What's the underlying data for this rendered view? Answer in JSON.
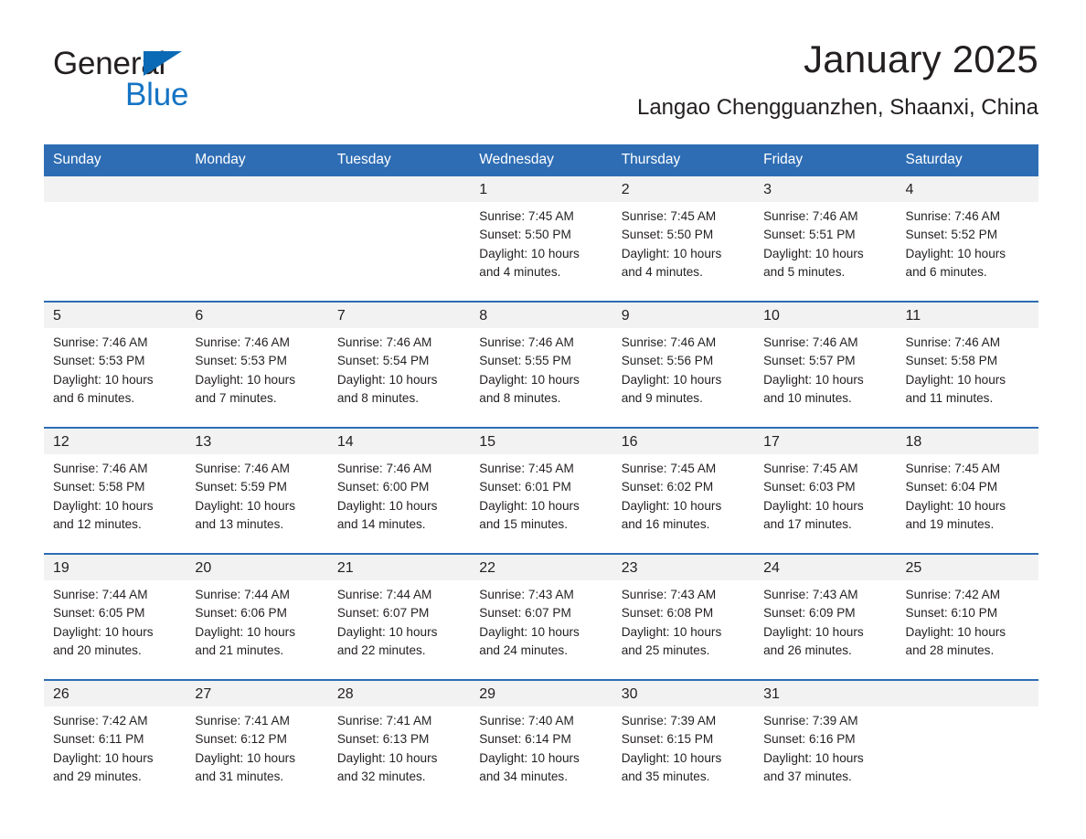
{
  "brand": {
    "name_part1": "General",
    "name_part2": "Blue",
    "accent_color": "#1574c4",
    "triangle_color": "#0b6ab5"
  },
  "header": {
    "title": "January 2025",
    "subtitle": "Langao Chengguanzhen, Shaanxi, China"
  },
  "theme": {
    "header_blue": "#2e6db4",
    "daynum_band": "#f2f2f2",
    "text": "#231f20"
  },
  "weekdays": [
    "Sunday",
    "Monday",
    "Tuesday",
    "Wednesday",
    "Thursday",
    "Friday",
    "Saturday"
  ],
  "weeks": [
    [
      {
        "day": "",
        "sunrise": "",
        "sunset": "",
        "daylight1": "",
        "daylight2": ""
      },
      {
        "day": "",
        "sunrise": "",
        "sunset": "",
        "daylight1": "",
        "daylight2": ""
      },
      {
        "day": "",
        "sunrise": "",
        "sunset": "",
        "daylight1": "",
        "daylight2": ""
      },
      {
        "day": "1",
        "sunrise": "Sunrise: 7:45 AM",
        "sunset": "Sunset: 5:50 PM",
        "daylight1": "Daylight: 10 hours",
        "daylight2": "and 4 minutes."
      },
      {
        "day": "2",
        "sunrise": "Sunrise: 7:45 AM",
        "sunset": "Sunset: 5:50 PM",
        "daylight1": "Daylight: 10 hours",
        "daylight2": "and 4 minutes."
      },
      {
        "day": "3",
        "sunrise": "Sunrise: 7:46 AM",
        "sunset": "Sunset: 5:51 PM",
        "daylight1": "Daylight: 10 hours",
        "daylight2": "and 5 minutes."
      },
      {
        "day": "4",
        "sunrise": "Sunrise: 7:46 AM",
        "sunset": "Sunset: 5:52 PM",
        "daylight1": "Daylight: 10 hours",
        "daylight2": "and 6 minutes."
      }
    ],
    [
      {
        "day": "5",
        "sunrise": "Sunrise: 7:46 AM",
        "sunset": "Sunset: 5:53 PM",
        "daylight1": "Daylight: 10 hours",
        "daylight2": "and 6 minutes."
      },
      {
        "day": "6",
        "sunrise": "Sunrise: 7:46 AM",
        "sunset": "Sunset: 5:53 PM",
        "daylight1": "Daylight: 10 hours",
        "daylight2": "and 7 minutes."
      },
      {
        "day": "7",
        "sunrise": "Sunrise: 7:46 AM",
        "sunset": "Sunset: 5:54 PM",
        "daylight1": "Daylight: 10 hours",
        "daylight2": "and 8 minutes."
      },
      {
        "day": "8",
        "sunrise": "Sunrise: 7:46 AM",
        "sunset": "Sunset: 5:55 PM",
        "daylight1": "Daylight: 10 hours",
        "daylight2": "and 8 minutes."
      },
      {
        "day": "9",
        "sunrise": "Sunrise: 7:46 AM",
        "sunset": "Sunset: 5:56 PM",
        "daylight1": "Daylight: 10 hours",
        "daylight2": "and 9 minutes."
      },
      {
        "day": "10",
        "sunrise": "Sunrise: 7:46 AM",
        "sunset": "Sunset: 5:57 PM",
        "daylight1": "Daylight: 10 hours",
        "daylight2": "and 10 minutes."
      },
      {
        "day": "11",
        "sunrise": "Sunrise: 7:46 AM",
        "sunset": "Sunset: 5:58 PM",
        "daylight1": "Daylight: 10 hours",
        "daylight2": "and 11 minutes."
      }
    ],
    [
      {
        "day": "12",
        "sunrise": "Sunrise: 7:46 AM",
        "sunset": "Sunset: 5:58 PM",
        "daylight1": "Daylight: 10 hours",
        "daylight2": "and 12 minutes."
      },
      {
        "day": "13",
        "sunrise": "Sunrise: 7:46 AM",
        "sunset": "Sunset: 5:59 PM",
        "daylight1": "Daylight: 10 hours",
        "daylight2": "and 13 minutes."
      },
      {
        "day": "14",
        "sunrise": "Sunrise: 7:46 AM",
        "sunset": "Sunset: 6:00 PM",
        "daylight1": "Daylight: 10 hours",
        "daylight2": "and 14 minutes."
      },
      {
        "day": "15",
        "sunrise": "Sunrise: 7:45 AM",
        "sunset": "Sunset: 6:01 PM",
        "daylight1": "Daylight: 10 hours",
        "daylight2": "and 15 minutes."
      },
      {
        "day": "16",
        "sunrise": "Sunrise: 7:45 AM",
        "sunset": "Sunset: 6:02 PM",
        "daylight1": "Daylight: 10 hours",
        "daylight2": "and 16 minutes."
      },
      {
        "day": "17",
        "sunrise": "Sunrise: 7:45 AM",
        "sunset": "Sunset: 6:03 PM",
        "daylight1": "Daylight: 10 hours",
        "daylight2": "and 17 minutes."
      },
      {
        "day": "18",
        "sunrise": "Sunrise: 7:45 AM",
        "sunset": "Sunset: 6:04 PM",
        "daylight1": "Daylight: 10 hours",
        "daylight2": "and 19 minutes."
      }
    ],
    [
      {
        "day": "19",
        "sunrise": "Sunrise: 7:44 AM",
        "sunset": "Sunset: 6:05 PM",
        "daylight1": "Daylight: 10 hours",
        "daylight2": "and 20 minutes."
      },
      {
        "day": "20",
        "sunrise": "Sunrise: 7:44 AM",
        "sunset": "Sunset: 6:06 PM",
        "daylight1": "Daylight: 10 hours",
        "daylight2": "and 21 minutes."
      },
      {
        "day": "21",
        "sunrise": "Sunrise: 7:44 AM",
        "sunset": "Sunset: 6:07 PM",
        "daylight1": "Daylight: 10 hours",
        "daylight2": "and 22 minutes."
      },
      {
        "day": "22",
        "sunrise": "Sunrise: 7:43 AM",
        "sunset": "Sunset: 6:07 PM",
        "daylight1": "Daylight: 10 hours",
        "daylight2": "and 24 minutes."
      },
      {
        "day": "23",
        "sunrise": "Sunrise: 7:43 AM",
        "sunset": "Sunset: 6:08 PM",
        "daylight1": "Daylight: 10 hours",
        "daylight2": "and 25 minutes."
      },
      {
        "day": "24",
        "sunrise": "Sunrise: 7:43 AM",
        "sunset": "Sunset: 6:09 PM",
        "daylight1": "Daylight: 10 hours",
        "daylight2": "and 26 minutes."
      },
      {
        "day": "25",
        "sunrise": "Sunrise: 7:42 AM",
        "sunset": "Sunset: 6:10 PM",
        "daylight1": "Daylight: 10 hours",
        "daylight2": "and 28 minutes."
      }
    ],
    [
      {
        "day": "26",
        "sunrise": "Sunrise: 7:42 AM",
        "sunset": "Sunset: 6:11 PM",
        "daylight1": "Daylight: 10 hours",
        "daylight2": "and 29 minutes."
      },
      {
        "day": "27",
        "sunrise": "Sunrise: 7:41 AM",
        "sunset": "Sunset: 6:12 PM",
        "daylight1": "Daylight: 10 hours",
        "daylight2": "and 31 minutes."
      },
      {
        "day": "28",
        "sunrise": "Sunrise: 7:41 AM",
        "sunset": "Sunset: 6:13 PM",
        "daylight1": "Daylight: 10 hours",
        "daylight2": "and 32 minutes."
      },
      {
        "day": "29",
        "sunrise": "Sunrise: 7:40 AM",
        "sunset": "Sunset: 6:14 PM",
        "daylight1": "Daylight: 10 hours",
        "daylight2": "and 34 minutes."
      },
      {
        "day": "30",
        "sunrise": "Sunrise: 7:39 AM",
        "sunset": "Sunset: 6:15 PM",
        "daylight1": "Daylight: 10 hours",
        "daylight2": "and 35 minutes."
      },
      {
        "day": "31",
        "sunrise": "Sunrise: 7:39 AM",
        "sunset": "Sunset: 6:16 PM",
        "daylight1": "Daylight: 10 hours",
        "daylight2": "and 37 minutes."
      },
      {
        "day": "",
        "sunrise": "",
        "sunset": "",
        "daylight1": "",
        "daylight2": ""
      }
    ]
  ]
}
